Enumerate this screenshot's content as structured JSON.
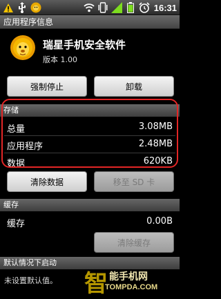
{
  "status_bar": {
    "time": "16:31",
    "left_icons": [
      "warning-icon",
      "usb-icon",
      "lion-app-icon"
    ],
    "right_icons": [
      "wifi-icon",
      "vibrate-icon",
      "signal-icon",
      "battery-icon",
      "alarm-icon"
    ]
  },
  "title_bar": {
    "title": "应用程序信息"
  },
  "app": {
    "name": "瑞星手机安全软件",
    "version": "版本 1.00",
    "icon": "lion-icon"
  },
  "buttons": {
    "force_stop": "强制停止",
    "uninstall": "卸载",
    "clear_data": "清除数据",
    "move_to_sd": "移至 SD 卡",
    "clear_cache": "清除缓存"
  },
  "storage": {
    "header": "存储",
    "rows": [
      {
        "label": "总量",
        "value": "3.08MB"
      },
      {
        "label": "应用程序",
        "value": "2.48MB"
      },
      {
        "label": "数据",
        "value": "620KB"
      }
    ]
  },
  "cache": {
    "header": "缓存",
    "row": {
      "label": "缓存",
      "value": "0.00B"
    }
  },
  "defaults": {
    "header": "默认情况下启动",
    "text": "未设置默认值。"
  },
  "watermark": {
    "text": "能手机网",
    "url": "TOMPDA.COM"
  },
  "colors": {
    "highlight": "#e32626",
    "button_bg": "#e6e6e6",
    "header_bg": "#555555"
  }
}
